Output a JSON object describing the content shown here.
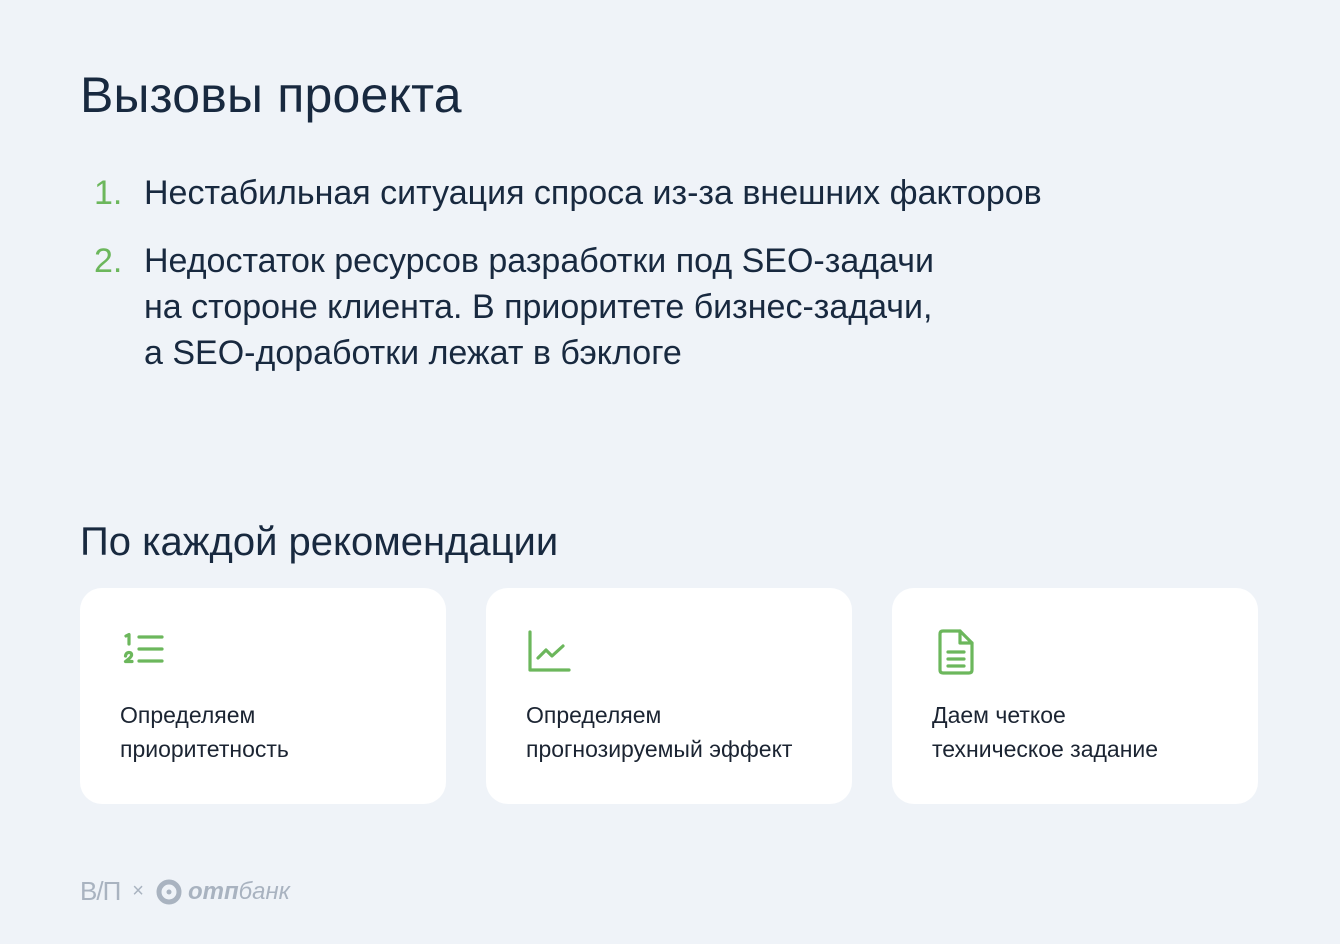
{
  "title": "Вызовы проекта",
  "challenges": [
    {
      "num": "1.",
      "lines": [
        "Нестабильная ситуация спроса из-за внешних факторов"
      ]
    },
    {
      "num": "2.",
      "lines": [
        "Недостаток ресурсов разработки под SEO-задачи",
        "на стороне клиента. В приоритете бизнес-задачи,",
        "а SEO-доработки лежат в бэклоге"
      ]
    }
  ],
  "subtitle": "По каждой рекомендации",
  "cards": [
    {
      "icon": "numbered-list-icon",
      "lines": [
        "Определяем",
        "приоритетность"
      ]
    },
    {
      "icon": "line-chart-icon",
      "lines": [
        "Определяем",
        "прогнозируемый эффект"
      ]
    },
    {
      "icon": "document-icon",
      "lines": [
        "Даем четкое",
        "техническое задание"
      ]
    }
  ],
  "footer": {
    "brand_left": "В/П",
    "separator": "×",
    "brand_right_bold": "отп",
    "brand_right": "банк"
  },
  "colors": {
    "accent": "#6cb75c",
    "background": "#eff3f8",
    "text": "#18293f"
  }
}
